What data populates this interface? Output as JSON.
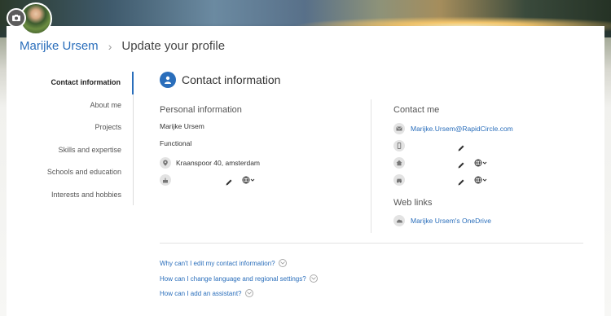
{
  "header": {
    "user_name": "Marijke Ursem",
    "page_title": "Update your profile"
  },
  "nav": {
    "items": [
      {
        "label": "Contact information",
        "active": true
      },
      {
        "label": "About me"
      },
      {
        "label": "Projects"
      },
      {
        "label": "Skills and expertise"
      },
      {
        "label": "Schools and education"
      },
      {
        "label": "Interests and hobbies"
      }
    ]
  },
  "section": {
    "title": "Contact information"
  },
  "personal": {
    "heading": "Personal information",
    "name": "Marijke Ursem",
    "title": "Functional",
    "address": "Kraanspoor 40, amsterdam"
  },
  "contact": {
    "heading": "Contact me",
    "email": "Marijke.Ursem@RapidCircle.com"
  },
  "weblinks": {
    "heading": "Web links",
    "onedrive": "Marijke Ursem's OneDrive"
  },
  "faq": {
    "items": [
      "Why can't I edit my contact information?",
      "How can I change language and regional settings?",
      "How can I add an assistant?"
    ]
  },
  "colors": {
    "accent": "#2a6ebb"
  },
  "icons": [
    "camera-icon",
    "user-icon",
    "location-icon",
    "cake-icon",
    "pencil-icon",
    "globe-icon",
    "mail-icon",
    "mobile-icon",
    "home-icon",
    "car-icon",
    "cloud-icon",
    "chevron-down-icon"
  ]
}
